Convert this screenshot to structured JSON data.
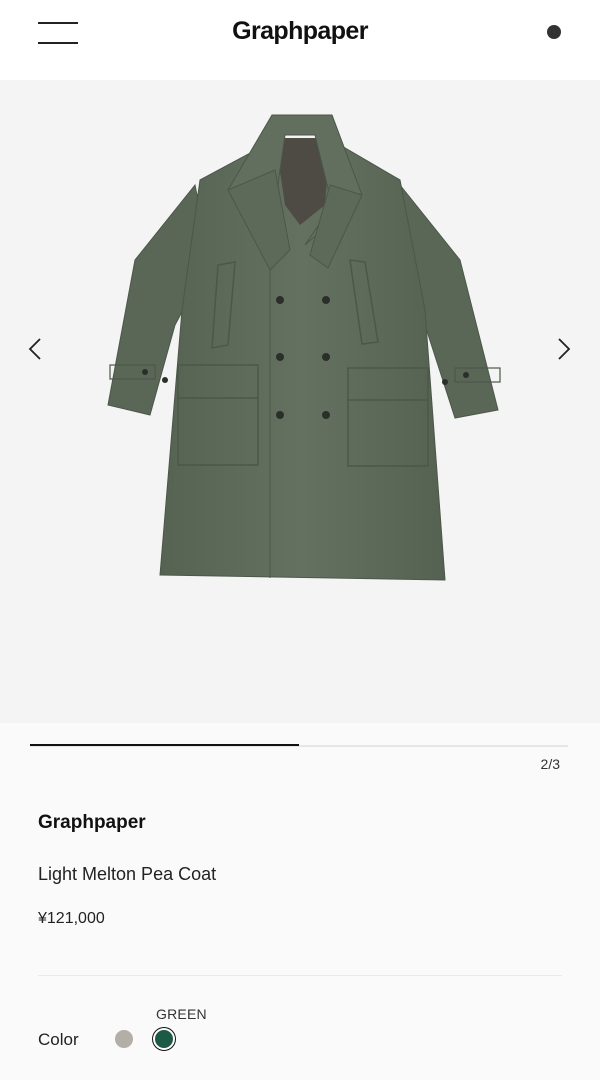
{
  "header": {
    "logo": "Graphpaper",
    "menu_icon": "hamburger-menu-icon",
    "status_icon": "dot-icon"
  },
  "gallery": {
    "prev_icon": "chevron-left-icon",
    "next_icon": "chevron-right-icon",
    "current": 2,
    "total": 3,
    "pager_text": "2/3",
    "progress_fraction": 0.5,
    "background_color": "#f4f4f4",
    "coat_color": "#5e6b5b"
  },
  "product": {
    "brand": "Graphpaper",
    "name": "Light Melton Pea Coat",
    "price": "¥121,000"
  },
  "color_selector": {
    "label": "Color",
    "selected_name": "GREEN",
    "swatches": [
      {
        "name": "grey",
        "color": "#b3afa6",
        "selected": false
      },
      {
        "name": "green",
        "color": "#1d5a45",
        "selected": true
      }
    ]
  }
}
